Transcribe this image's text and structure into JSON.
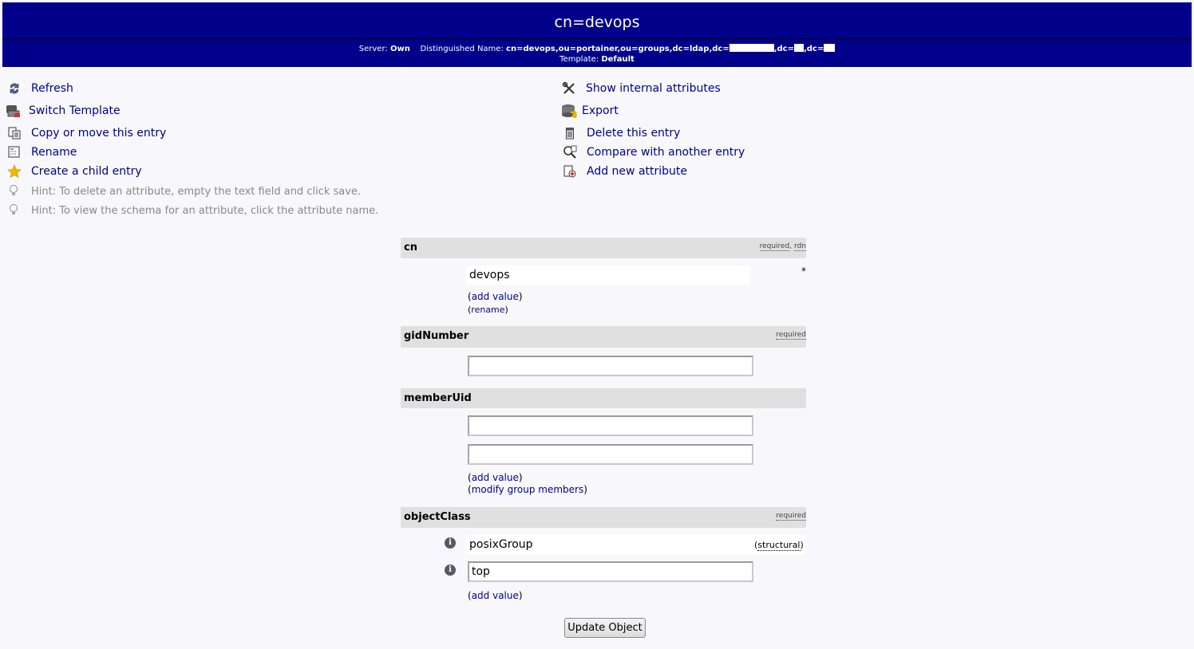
{
  "header": {
    "title": "cn=devops",
    "server_label": "Server:",
    "server_value": "Own",
    "dn_label": "Distinguished Name:",
    "dn_part1": "cn=devops,ou=portainer,ou=groups,dc=ldap,dc=",
    "dn_part2": ",dc=",
    "dn_part3": ",dc=",
    "template_label": "Template:",
    "template_value": "Default"
  },
  "menu": {
    "left": [
      {
        "label": "Refresh",
        "icon": "refresh-icon"
      },
      {
        "label": "Switch Template",
        "icon": "switch-template-icon"
      },
      {
        "label": "Copy or move this entry",
        "icon": "copy-icon"
      },
      {
        "label": "Rename",
        "icon": "rename-icon"
      },
      {
        "label": "Create a child entry",
        "icon": "star-icon"
      }
    ],
    "right": [
      {
        "label": "Show internal attributes",
        "icon": "tools-icon"
      },
      {
        "label": "Export",
        "icon": "export-icon"
      },
      {
        "label": "Delete this entry",
        "icon": "trash-icon"
      },
      {
        "label": "Compare with another entry",
        "icon": "compare-icon"
      },
      {
        "label": "Add new attribute",
        "icon": "add-attribute-icon"
      }
    ],
    "hints": [
      "Hint: To delete an attribute, empty the text field and click save.",
      "Hint: To view the schema for an attribute, click the attribute name."
    ]
  },
  "attributes": {
    "cn": {
      "name": "cn",
      "flag_required": "required",
      "flag_sep": ",",
      "flag_rdn": "rdn",
      "value": "devops",
      "asterisk": "*",
      "add_value": "add value",
      "rename": "rename"
    },
    "gidNumber": {
      "name": "gidNumber",
      "flag_required": "required",
      "value": ""
    },
    "memberUid": {
      "name": "memberUid",
      "value1": "",
      "value2": "",
      "add_value": "add value",
      "modify_members": "modify group members"
    },
    "objectClass": {
      "name": "objectClass",
      "flag_required": "required",
      "value1": "posixGroup",
      "value1_type": "structural",
      "value2": "top",
      "add_value": "add value"
    }
  },
  "buttons": {
    "update": "Update Object"
  },
  "colors": {
    "header_bg": "#00008b",
    "link": "#00008b",
    "attr_header_bg": "#e0e0e0",
    "hint": "#888888"
  }
}
